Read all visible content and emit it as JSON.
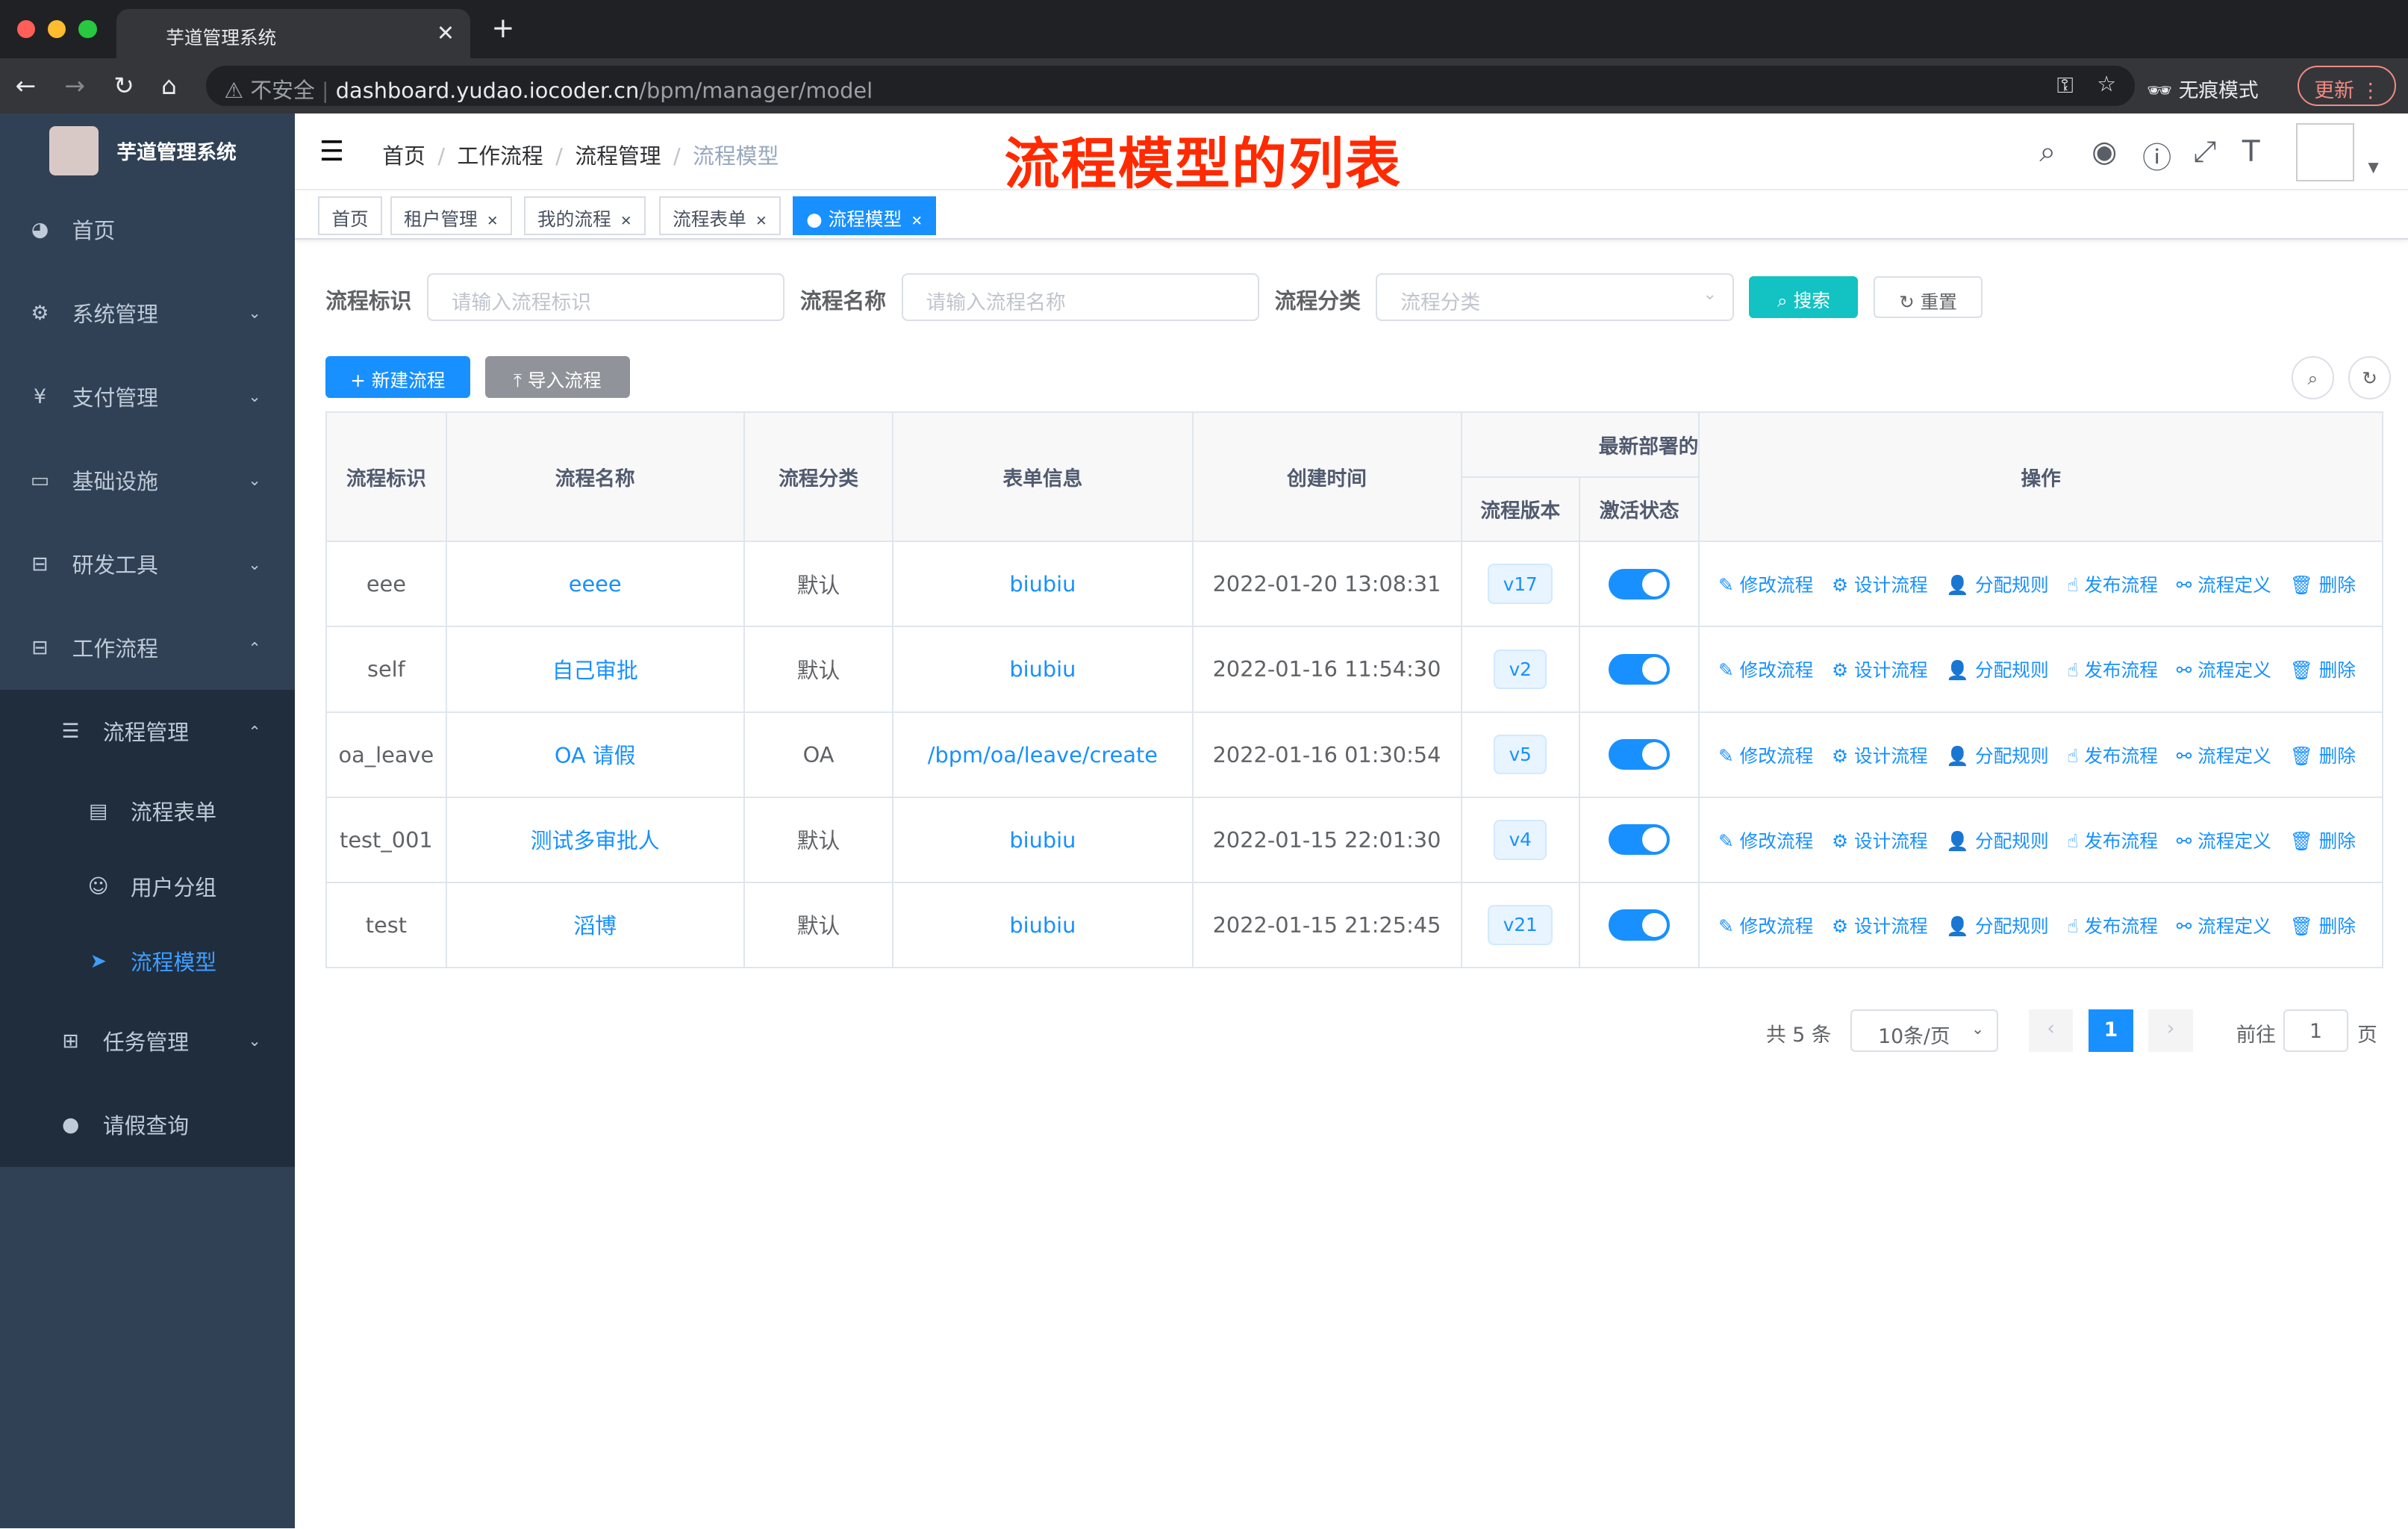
{
  "browser": {
    "tab_title": "芋道管理系统",
    "url_insecure": "不安全",
    "url_host": "dashboard.yudao.iocoder.cn",
    "url_path": "/bpm/manager/model",
    "incognito": "无痕模式",
    "update": "更新"
  },
  "sidebar": {
    "title": "芋道管理系统",
    "items": [
      {
        "label": "首页",
        "icon": "dashboard-icon"
      },
      {
        "label": "系统管理",
        "icon": "gear-icon"
      },
      {
        "label": "支付管理",
        "icon": "yen-icon"
      },
      {
        "label": "基础设施",
        "icon": "monitor-icon"
      },
      {
        "label": "研发工具",
        "icon": "toolbox-icon"
      },
      {
        "label": "工作流程",
        "icon": "toolbox-icon"
      }
    ],
    "sub": {
      "label": "流程管理",
      "items": [
        {
          "label": "流程表单"
        },
        {
          "label": "用户分组"
        },
        {
          "label": "流程模型"
        }
      ]
    },
    "after": [
      {
        "label": "任务管理"
      },
      {
        "label": "请假查询"
      }
    ]
  },
  "header": {
    "breadcrumb": [
      "首页",
      "工作流程",
      "流程管理",
      "流程模型"
    ],
    "annotation": "流程模型的列表"
  },
  "tags": [
    {
      "label": "首页"
    },
    {
      "label": "租户管理"
    },
    {
      "label": "我的流程"
    },
    {
      "label": "流程表单"
    },
    {
      "label": "流程模型"
    }
  ],
  "filters": {
    "key_label": "流程标识",
    "key_placeholder": "请输入流程标识",
    "name_label": "流程名称",
    "name_placeholder": "请输入流程名称",
    "cat_label": "流程分类",
    "cat_placeholder": "流程分类",
    "search": "搜索",
    "reset": "重置"
  },
  "toolbar": {
    "create": "新建流程",
    "import": "导入流程"
  },
  "table": {
    "headers": {
      "key": "流程标识",
      "name": "流程名称",
      "category": "流程分类",
      "form": "表单信息",
      "created": "创建时间",
      "deploy": "最新部署的",
      "version": "流程版本",
      "status": "激活状态",
      "ops": "操作"
    },
    "ops": [
      "修改流程",
      "设计流程",
      "分配规则",
      "发布流程",
      "流程定义",
      "删除"
    ],
    "rows": [
      {
        "key": "eee",
        "name": "eeee",
        "category": "默认",
        "form": "biubiu",
        "created": "2022-01-20 13:08:31",
        "version": "v17",
        "active": true
      },
      {
        "key": "self",
        "name": "自己审批",
        "category": "默认",
        "form": "biubiu",
        "created": "2022-01-16 11:54:30",
        "version": "v2",
        "active": true
      },
      {
        "key": "oa_leave",
        "name": "OA 请假",
        "category": "OA",
        "form": "/bpm/oa/leave/create",
        "created": "2022-01-16 01:30:54",
        "version": "v5",
        "active": true
      },
      {
        "key": "test_001",
        "name": "测试多审批人",
        "category": "默认",
        "form": "biubiu",
        "created": "2022-01-15 22:01:30",
        "version": "v4",
        "active": true
      },
      {
        "key": "test",
        "name": "滔博",
        "category": "默认",
        "form": "biubiu",
        "created": "2022-01-15 21:25:45",
        "version": "v21",
        "active": true
      }
    ]
  },
  "pagination": {
    "total": "共 5 条",
    "size": "10条/页",
    "page": "1",
    "goto": "前往",
    "goto_value": "1",
    "unit": "页"
  },
  "colors": {
    "primary": "#1890ff",
    "sidebar": "#304156",
    "search": "#13c2c2",
    "annotation": "#ff2a00"
  }
}
